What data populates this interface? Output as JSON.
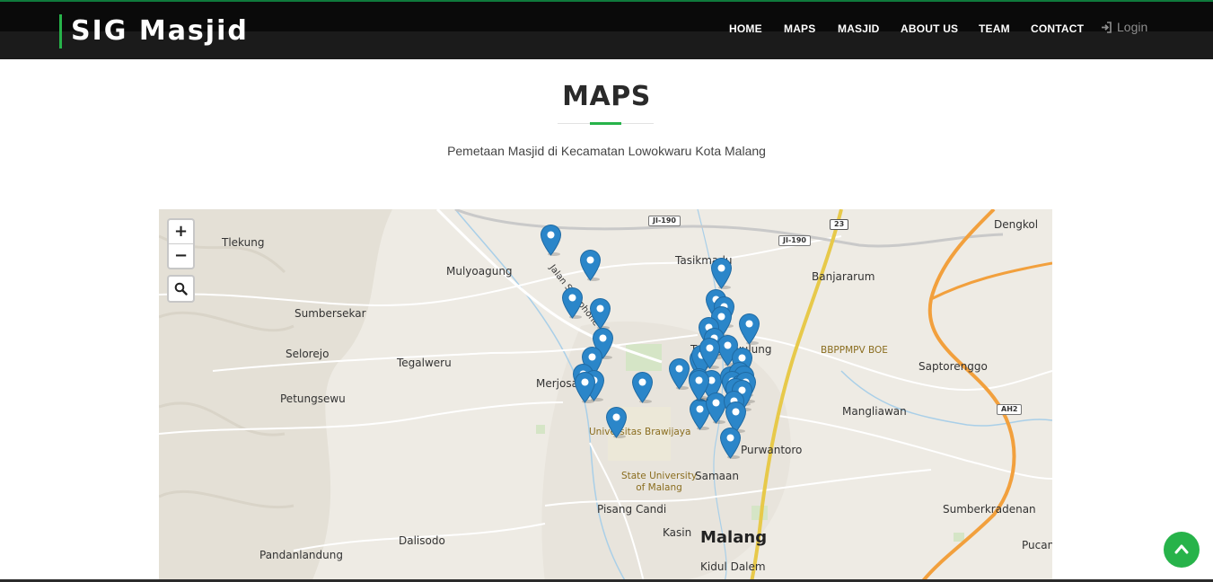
{
  "brand": {
    "title": "SIG Masjid",
    "accent_color": "#27b34a"
  },
  "nav": {
    "items": [
      "HOME",
      "MAPS",
      "MASJID",
      "ABOUT US",
      "TEAM",
      "CONTACT"
    ],
    "login_label": "Login",
    "login_icon": "sign-in-icon"
  },
  "section": {
    "title": "MAPS",
    "subtitle": "Pemetaan Masjid di Kecamatan Lowokwaru Kota Malang"
  },
  "map": {
    "zoom_in": "+",
    "zoom_out": "−",
    "search_icon": "search-icon",
    "places": [
      "Tlekung",
      "Mulyoagung",
      "Tasikmadu",
      "Banjararum",
      "Dengkol",
      "Sumbersekar",
      "Selorejo",
      "Tegalweru",
      "Merjosari",
      "Petungsewu",
      "Tunggulwulung",
      "Universitas Brawijaya",
      "State University of Malang",
      "Purwantoro",
      "Samaan",
      "Mangliawan",
      "Saptorenggo",
      "Pisang Candi",
      "Kasin",
      "Malang",
      "Kidul Dalem",
      "Dalisodo",
      "Pandanlandung",
      "Sumberkradenan",
      "Pucang",
      "BBPPMPV BOE",
      "Jalan Saxophone"
    ],
    "road_shields": [
      "JI-190",
      "JI-190",
      "23",
      "AH2"
    ],
    "marker_color": "#2b86c9",
    "marker_icon": "map-pin-icon",
    "marker_count": 40
  },
  "back_to_top": {
    "icon": "chevron-up-icon",
    "color": "#27b34a"
  }
}
